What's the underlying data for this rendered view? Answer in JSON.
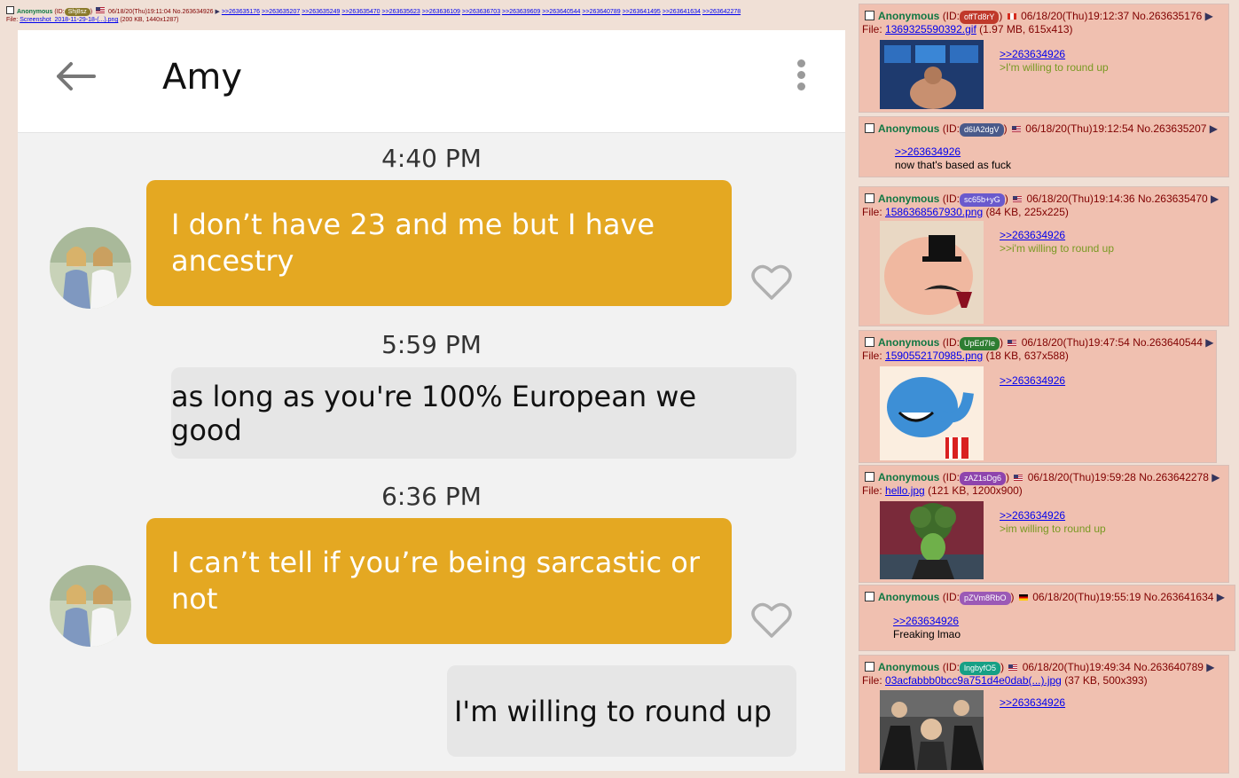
{
  "op": {
    "name": "Anonymous",
    "id_prefix": "(ID:",
    "id": "Shj8sz",
    "id_suffix": ")",
    "datetime": "06/18/20(Thu)19:11:04",
    "post_no": "No.263634926",
    "backlinks": [
      ">>263635176",
      ">>263635207",
      ">>263635249",
      ">>263635470",
      ">>263635623",
      ">>263636109",
      ">>263636703",
      ">>263639609",
      ">>263640544",
      ">>263640789",
      ">>263641495",
      ">>263641634",
      ">>263642278"
    ],
    "file_label": "File:",
    "file_name": "Screenshot_2018-11-29-18-(...).png",
    "file_meta": "(200 KB, 1440x1287)"
  },
  "phone": {
    "contact_name": "Amy",
    "messages": [
      {
        "time": "4:40 PM",
        "direction": "in",
        "text": "I don’t have 23 and me but I have ancestry"
      },
      {
        "time": "5:59 PM",
        "direction": "out",
        "text": "as long as you're 100% European we good"
      },
      {
        "time": "6:36 PM",
        "direction": "in",
        "text": "I can’t tell if you’re being sarcastic or not"
      },
      {
        "time": "",
        "direction": "out",
        "text": "I'm willing to round up"
      }
    ],
    "colors": {
      "incoming_bubble": "#e4a822",
      "outgoing_bubble": "#e6e6e6",
      "background": "#f2f2f2"
    }
  },
  "replies": [
    {
      "name": "Anonymous",
      "id_prefix": "(ID:",
      "id": "offTd8rY",
      "id_suffix": ")",
      "id_color": "#c0392b",
      "flag": "ca",
      "datetime": "06/18/20(Thu)19:12:37",
      "post_no": "No.263635176",
      "file_label": "File:",
      "file_name": "1369325590392.gif",
      "file_meta": "(1.97 MB, 615x413)",
      "quote": ">>263634926",
      "text": ">I'm willing to round up",
      "text_green": true
    },
    {
      "name": "Anonymous",
      "id_prefix": "(ID:",
      "id": "d6IA2dgV",
      "id_suffix": ")",
      "id_color": "#4a5a8a",
      "flag": "us",
      "datetime": "06/18/20(Thu)19:12:54",
      "post_no": "No.263635207",
      "quote": ">>263634926",
      "text": "now that's based as fuck",
      "text_green": false
    },
    {
      "name": "Anonymous",
      "id_prefix": "(ID:",
      "id": "sc65b+yG",
      "id_suffix": ")",
      "id_color": "#6a5acd",
      "flag": "us",
      "datetime": "06/18/20(Thu)19:14:36",
      "post_no": "No.263635470",
      "file_label": "File:",
      "file_name": "1586368567930.png",
      "file_meta": "(84 KB, 225x225)",
      "quote": ">>263634926",
      "text": ">>i'm willing to round up",
      "text_green": true
    },
    {
      "name": "Anonymous",
      "id_prefix": "(ID:",
      "id": "UpEd7Ie",
      "id_suffix": ")",
      "id_color": "#2e7d32",
      "flag": "us",
      "datetime": "06/18/20(Thu)19:47:54",
      "post_no": "No.263640544",
      "file_label": "File:",
      "file_name": "1590552170985.png",
      "file_meta": "(18 KB, 637x588)",
      "quote": ">>263634926",
      "text": "",
      "text_green": false
    },
    {
      "name": "Anonymous",
      "id_prefix": "(ID:",
      "id": "zAZ1sDg6",
      "id_suffix": ")",
      "id_color": "#8e44ad",
      "flag": "us",
      "datetime": "06/18/20(Thu)19:59:28",
      "post_no": "No.263642278",
      "file_label": "File:",
      "file_name": "hello.jpg",
      "file_meta": "(121 KB, 1200x900)",
      "quote": ">>263634926",
      "text": ">im willing to round up",
      "text_green": true
    },
    {
      "name": "Anonymous",
      "id_prefix": "(ID:",
      "id": "pZVm8RbO",
      "id_suffix": ")",
      "id_color": "#9b59b6",
      "flag": "de",
      "datetime": "06/18/20(Thu)19:55:19",
      "post_no": "No.263641634",
      "quote": ">>263634926",
      "text": "Freaking lmao",
      "text_green": false
    },
    {
      "name": "Anonymous",
      "id_prefix": "(ID:",
      "id": "lngbyfO5",
      "id_suffix": ")",
      "id_color": "#16a085",
      "flag": "us",
      "datetime": "06/18/20(Thu)19:49:34",
      "post_no": "No.263640789",
      "file_label": "File:",
      "file_name": "03acfabbb0bcc9a751d4e0dab(...).jpg",
      "file_meta": "(37 KB, 500x393)",
      "quote": ">>263634926",
      "text": "",
      "text_green": false
    }
  ]
}
